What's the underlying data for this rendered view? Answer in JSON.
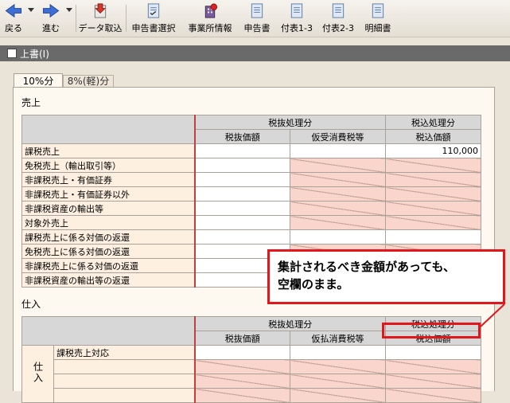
{
  "toolbar": {
    "back": "戻る",
    "forward": "進む",
    "import": "データ取込",
    "select_form": "申告書選択",
    "office_info": "事業所情報",
    "form": "申告書",
    "table_1_3": "付表1-3",
    "table_2_3": "付表2-3",
    "details": "明細書"
  },
  "statusbar": {
    "overwrite": "上書(I)"
  },
  "tabs": [
    {
      "label": "10%分"
    },
    {
      "label": "8%(軽)分"
    }
  ],
  "sales": {
    "section_label": "売上",
    "group_headers": [
      "税抜処理分",
      "税込処理分"
    ],
    "col_headers": [
      "税抜価額",
      "仮受消費税等",
      "税込価額"
    ],
    "rows": [
      {
        "label": "課税売上",
        "c1": "",
        "c2": "",
        "c3": "110,000"
      },
      {
        "label": "免税売上（輸出取引等）",
        "c1": "",
        "c2": "",
        "c3": ""
      },
      {
        "label": "非課税売上・有価証券",
        "c1": "",
        "c2": "",
        "c3": ""
      },
      {
        "label": "非課税売上・有価証券以外",
        "c1": "",
        "c2": "",
        "c3": ""
      },
      {
        "label": "非課税資産の輸出等",
        "c1": "",
        "c2": "",
        "c3": ""
      },
      {
        "label": "対象外売上",
        "c1": "",
        "c2": "",
        "c3": ""
      },
      {
        "label": "課税売上に係る対価の返還",
        "c1": "",
        "c2": "",
        "c3": ""
      },
      {
        "label": "免税売上に係る対価の返還",
        "c1": "",
        "c2": "",
        "c3": ""
      },
      {
        "label": "非課税売上に係る対価の返還",
        "c1": "",
        "c2": "",
        "c3": ""
      },
      {
        "label": "非課税資産の輸出等の返還",
        "c1": "",
        "c2": "",
        "c3": ""
      }
    ]
  },
  "purchases": {
    "section_label": "仕入",
    "group_headers": [
      "税抜処理分",
      "税込処理分"
    ],
    "col_headers": [
      "税抜価額",
      "仮払消費税等",
      "税込価額"
    ],
    "side_label": "仕入",
    "rows": [
      {
        "label": "課税売上対応"
      }
    ]
  },
  "callout": {
    "line1": "集計されるべき金額があっても、",
    "line2": "空欄のまま。"
  },
  "colors": {
    "accent_red": "#e2161b",
    "pink_cell": "#f9d5cb",
    "label_cell": "#fdf0e0",
    "header_gray": "#d7d7d7"
  }
}
